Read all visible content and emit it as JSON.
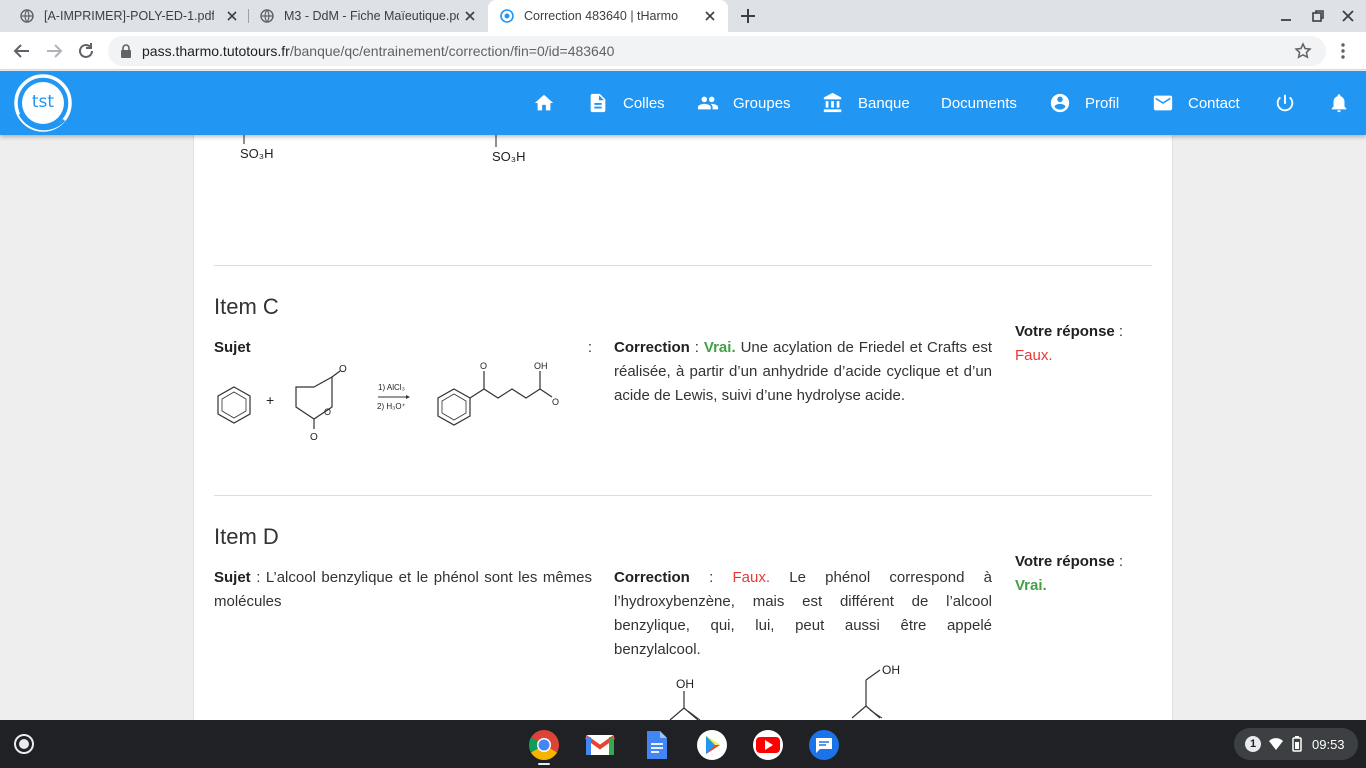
{
  "tabs": [
    {
      "title": "[A-IMPRIMER]-POLY-ED-1.pdf"
    },
    {
      "title": "M3 - DdM - Fiche Maïeutique.pdf"
    },
    {
      "title": "Correction 483640 | tHarmo",
      "active": true
    }
  ],
  "address": {
    "host": "pass.tharmo.tutotours.fr",
    "path": "/banque/qc/entrainement/correction/fin=0/id=483640"
  },
  "nav": {
    "colles": "Colles",
    "groupes": "Groupes",
    "banque": "Banque",
    "documents": "Documents",
    "profil": "Profil",
    "contact": "Contact"
  },
  "top_fragment": {
    "left_label": "SO₃H",
    "right_label": "SO₃H"
  },
  "items": [
    {
      "title": "Item C",
      "sujet_label": "Sujet",
      "sujet_colon": ":",
      "sujet_text": "",
      "scheme": {
        "reagent1": "1) AlCl₃",
        "reagent2": "2) H₃O⁺",
        "plus": "+",
        "oh": "OH",
        "o": "O"
      },
      "correction_label": "Correction",
      "correction_colon": ":",
      "verdict": "Vrai.",
      "correction_text": "Une acylation de Friedel et Crafts est réalisée, à partir d’un anhydride d’acide cyclique et d’un acide de Lewis, suivi d’une hydrolyse acide.",
      "answer_label": "Votre réponse",
      "answer_colon": ":",
      "answer_value": "Faux."
    },
    {
      "title": "Item D",
      "sujet_label": "Sujet",
      "sujet_colon": ":",
      "sujet_text": "L’alcool benzylique et le phénol sont les mêmes molécules",
      "correction_label": "Correction",
      "correction_colon": ":",
      "verdict": "Faux.",
      "correction_text": "Le phénol correspond à l’hydroxybenzène, mais est différent de l’alcool benzylique, qui, lui, peut aussi être appelé benzylalcool.",
      "answer_label": "Votre réponse",
      "answer_colon": ":",
      "answer_value": "Vrai.",
      "fig": {
        "oh1": "OH",
        "oh2": "OH"
      }
    }
  ],
  "tray": {
    "notifications": "1",
    "time": "09:53"
  },
  "colors": {
    "header": "#2196f3",
    "vrai": "#43a047",
    "faux": "#e53935"
  },
  "shelf_apps": [
    "chrome-icon",
    "gmail-icon",
    "docs-icon",
    "play-store-icon",
    "youtube-icon",
    "messages-icon"
  ]
}
